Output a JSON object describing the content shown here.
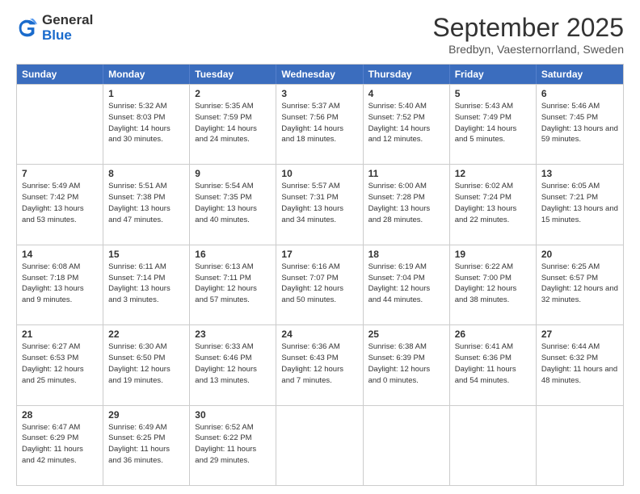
{
  "logo": {
    "general": "General",
    "blue": "Blue"
  },
  "header": {
    "month": "September 2025",
    "location": "Bredbyn, Vaesternorrland, Sweden"
  },
  "weekdays": [
    "Sunday",
    "Monday",
    "Tuesday",
    "Wednesday",
    "Thursday",
    "Friday",
    "Saturday"
  ],
  "rows": [
    [
      {
        "day": "",
        "sunrise": "",
        "sunset": "",
        "daylight": ""
      },
      {
        "day": "1",
        "sunrise": "Sunrise: 5:32 AM",
        "sunset": "Sunset: 8:03 PM",
        "daylight": "Daylight: 14 hours and 30 minutes."
      },
      {
        "day": "2",
        "sunrise": "Sunrise: 5:35 AM",
        "sunset": "Sunset: 7:59 PM",
        "daylight": "Daylight: 14 hours and 24 minutes."
      },
      {
        "day": "3",
        "sunrise": "Sunrise: 5:37 AM",
        "sunset": "Sunset: 7:56 PM",
        "daylight": "Daylight: 14 hours and 18 minutes."
      },
      {
        "day": "4",
        "sunrise": "Sunrise: 5:40 AM",
        "sunset": "Sunset: 7:52 PM",
        "daylight": "Daylight: 14 hours and 12 minutes."
      },
      {
        "day": "5",
        "sunrise": "Sunrise: 5:43 AM",
        "sunset": "Sunset: 7:49 PM",
        "daylight": "Daylight: 14 hours and 5 minutes."
      },
      {
        "day": "6",
        "sunrise": "Sunrise: 5:46 AM",
        "sunset": "Sunset: 7:45 PM",
        "daylight": "Daylight: 13 hours and 59 minutes."
      }
    ],
    [
      {
        "day": "7",
        "sunrise": "Sunrise: 5:49 AM",
        "sunset": "Sunset: 7:42 PM",
        "daylight": "Daylight: 13 hours and 53 minutes."
      },
      {
        "day": "8",
        "sunrise": "Sunrise: 5:51 AM",
        "sunset": "Sunset: 7:38 PM",
        "daylight": "Daylight: 13 hours and 47 minutes."
      },
      {
        "day": "9",
        "sunrise": "Sunrise: 5:54 AM",
        "sunset": "Sunset: 7:35 PM",
        "daylight": "Daylight: 13 hours and 40 minutes."
      },
      {
        "day": "10",
        "sunrise": "Sunrise: 5:57 AM",
        "sunset": "Sunset: 7:31 PM",
        "daylight": "Daylight: 13 hours and 34 minutes."
      },
      {
        "day": "11",
        "sunrise": "Sunrise: 6:00 AM",
        "sunset": "Sunset: 7:28 PM",
        "daylight": "Daylight: 13 hours and 28 minutes."
      },
      {
        "day": "12",
        "sunrise": "Sunrise: 6:02 AM",
        "sunset": "Sunset: 7:24 PM",
        "daylight": "Daylight: 13 hours and 22 minutes."
      },
      {
        "day": "13",
        "sunrise": "Sunrise: 6:05 AM",
        "sunset": "Sunset: 7:21 PM",
        "daylight": "Daylight: 13 hours and 15 minutes."
      }
    ],
    [
      {
        "day": "14",
        "sunrise": "Sunrise: 6:08 AM",
        "sunset": "Sunset: 7:18 PM",
        "daylight": "Daylight: 13 hours and 9 minutes."
      },
      {
        "day": "15",
        "sunrise": "Sunrise: 6:11 AM",
        "sunset": "Sunset: 7:14 PM",
        "daylight": "Daylight: 13 hours and 3 minutes."
      },
      {
        "day": "16",
        "sunrise": "Sunrise: 6:13 AM",
        "sunset": "Sunset: 7:11 PM",
        "daylight": "Daylight: 12 hours and 57 minutes."
      },
      {
        "day": "17",
        "sunrise": "Sunrise: 6:16 AM",
        "sunset": "Sunset: 7:07 PM",
        "daylight": "Daylight: 12 hours and 50 minutes."
      },
      {
        "day": "18",
        "sunrise": "Sunrise: 6:19 AM",
        "sunset": "Sunset: 7:04 PM",
        "daylight": "Daylight: 12 hours and 44 minutes."
      },
      {
        "day": "19",
        "sunrise": "Sunrise: 6:22 AM",
        "sunset": "Sunset: 7:00 PM",
        "daylight": "Daylight: 12 hours and 38 minutes."
      },
      {
        "day": "20",
        "sunrise": "Sunrise: 6:25 AM",
        "sunset": "Sunset: 6:57 PM",
        "daylight": "Daylight: 12 hours and 32 minutes."
      }
    ],
    [
      {
        "day": "21",
        "sunrise": "Sunrise: 6:27 AM",
        "sunset": "Sunset: 6:53 PM",
        "daylight": "Daylight: 12 hours and 25 minutes."
      },
      {
        "day": "22",
        "sunrise": "Sunrise: 6:30 AM",
        "sunset": "Sunset: 6:50 PM",
        "daylight": "Daylight: 12 hours and 19 minutes."
      },
      {
        "day": "23",
        "sunrise": "Sunrise: 6:33 AM",
        "sunset": "Sunset: 6:46 PM",
        "daylight": "Daylight: 12 hours and 13 minutes."
      },
      {
        "day": "24",
        "sunrise": "Sunrise: 6:36 AM",
        "sunset": "Sunset: 6:43 PM",
        "daylight": "Daylight: 12 hours and 7 minutes."
      },
      {
        "day": "25",
        "sunrise": "Sunrise: 6:38 AM",
        "sunset": "Sunset: 6:39 PM",
        "daylight": "Daylight: 12 hours and 0 minutes."
      },
      {
        "day": "26",
        "sunrise": "Sunrise: 6:41 AM",
        "sunset": "Sunset: 6:36 PM",
        "daylight": "Daylight: 11 hours and 54 minutes."
      },
      {
        "day": "27",
        "sunrise": "Sunrise: 6:44 AM",
        "sunset": "Sunset: 6:32 PM",
        "daylight": "Daylight: 11 hours and 48 minutes."
      }
    ],
    [
      {
        "day": "28",
        "sunrise": "Sunrise: 6:47 AM",
        "sunset": "Sunset: 6:29 PM",
        "daylight": "Daylight: 11 hours and 42 minutes."
      },
      {
        "day": "29",
        "sunrise": "Sunrise: 6:49 AM",
        "sunset": "Sunset: 6:25 PM",
        "daylight": "Daylight: 11 hours and 36 minutes."
      },
      {
        "day": "30",
        "sunrise": "Sunrise: 6:52 AM",
        "sunset": "Sunset: 6:22 PM",
        "daylight": "Daylight: 11 hours and 29 minutes."
      },
      {
        "day": "",
        "sunrise": "",
        "sunset": "",
        "daylight": ""
      },
      {
        "day": "",
        "sunrise": "",
        "sunset": "",
        "daylight": ""
      },
      {
        "day": "",
        "sunrise": "",
        "sunset": "",
        "daylight": ""
      },
      {
        "day": "",
        "sunrise": "",
        "sunset": "",
        "daylight": ""
      }
    ]
  ]
}
